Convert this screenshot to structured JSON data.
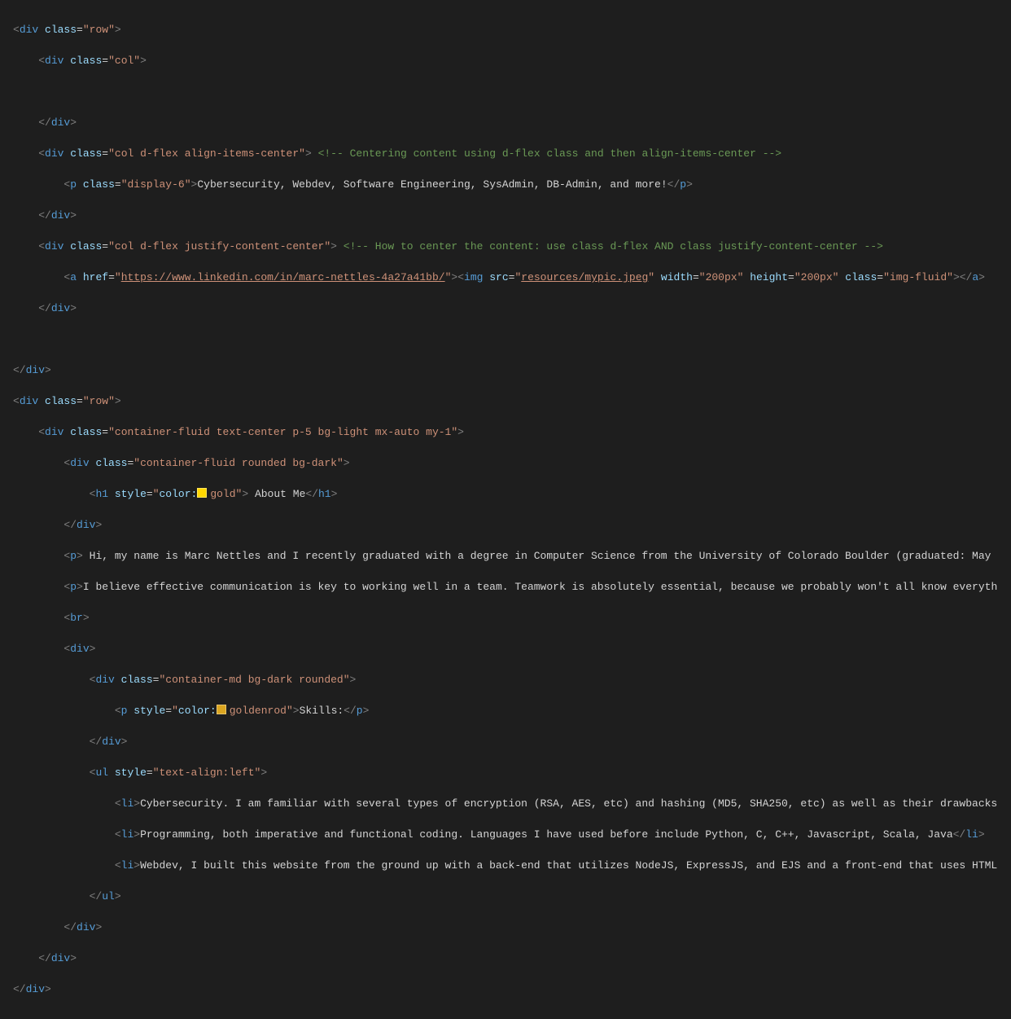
{
  "code": {
    "row1_open": {
      "clsAttr": "class",
      "clsVal": "row"
    },
    "col_empty": {
      "clsAttr": "class",
      "clsVal": "col"
    },
    "col_flex1": {
      "clsAttr": "class",
      "clsVal": "col d-flex align-items-center",
      "cmt": " Centering content using d-flex class and then align-items-center "
    },
    "p_display6": {
      "clsAttr": "class",
      "clsVal": "display-6",
      "text": "Cybersecurity, Webdev, Software Engineering, SysAdmin, DB-Admin, and more!"
    },
    "col_flex2": {
      "clsAttr": "class",
      "clsVal": "col d-flex justify-content-center",
      "cmt": " How to center the content: use class d-flex AND class justify-content-center "
    },
    "a": {
      "hrefAttr": "href",
      "hrefVal": "https://www.linkedin.com/in/marc-nettles-4a27a41bb/"
    },
    "img": {
      "srcAttr": "src",
      "srcVal": "resources/mypic.jpeg",
      "wAttr": "width",
      "wVal": "200px",
      "hAttr": "height",
      "hVal": "200px",
      "clsAttr": "class",
      "clsVal": "img-fluid"
    },
    "row2_open": {
      "clsAttr": "class",
      "clsVal": "row"
    },
    "container_outer": {
      "clsAttr": "class",
      "clsVal": "container-fluid text-center p-5 bg-light mx-auto my-1"
    },
    "container_inner": {
      "clsAttr": "class",
      "clsVal": "container-fluid rounded bg-dark"
    },
    "h1": {
      "styleAttr": "style",
      "colorProp": "color:",
      "colorName": "gold",
      "colorHex": "#ffd700",
      "text": " About Me"
    },
    "p_hi": "Hi, my name is Marc Nettles and I recently graduated with a degree in Computer Science from the University of Colorado Boulder (graduated: May ",
    "p_believe": "I believe effective communication is key to working well in a team. Teamwork is absolutely essential, because we probably won't all know everyth",
    "skills_container": {
      "clsAttr": "class",
      "clsVal": "container-md bg-dark rounded"
    },
    "skills_p": {
      "styleAttr": "style",
      "colorProp": "color:",
      "colorName": "goldenrod",
      "colorHex": "#daa520",
      "text": "Skills:"
    },
    "ul": {
      "styleAttr": "style",
      "styleVal": "text-align:left"
    },
    "li1": "Cybersecurity. I am familiar with several types of encryption (RSA, AES, etc) and hashing (MD5, SHA250, etc) as well as their drawbacks",
    "li2": "Programming, both imperative and functional coding. Languages I have used before include Python, C, C++, Javascript, Scala, Java",
    "li3": "Webdev, I built this website from the ground up with a back-end that utilizes NodeJS, ExpressJS, and EJS and a front-end that uses HTML"
  }
}
